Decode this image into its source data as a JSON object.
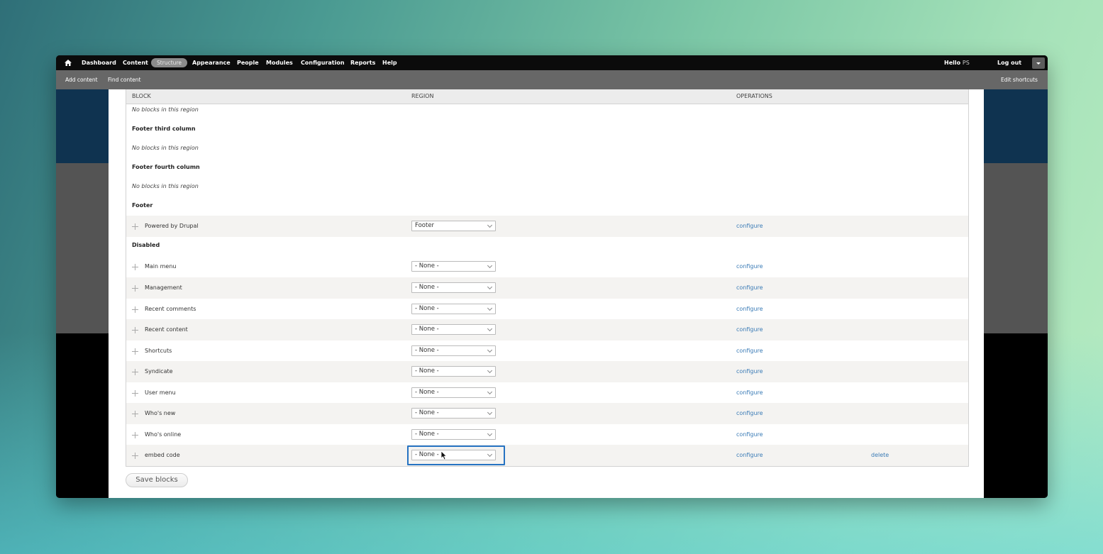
{
  "toolbar": {
    "dashboard": "Dashboard",
    "content": "Content",
    "structure": "Structure",
    "appearance": "Appearance",
    "people": "People",
    "modules": "Modules",
    "configuration": "Configuration",
    "reports": "Reports",
    "help": "Help",
    "hello_label": "Hello",
    "user_name": "PS",
    "logout": "Log out"
  },
  "shortcuts": {
    "add_content": "Add content",
    "find_content": "Find content",
    "edit_shortcuts": "Edit shortcuts"
  },
  "table": {
    "headers": [
      "BLOCK",
      "REGION",
      "OPERATIONS"
    ],
    "empty_text": "No blocks in this region",
    "regions": {
      "footer_third": "Footer third column",
      "footer_fourth": "Footer fourth column",
      "footer": "Footer",
      "disabled": "Disabled"
    },
    "rows": [
      {
        "block": "Powered by Drupal",
        "region": "Footer",
        "configure": "configure"
      },
      {
        "block": "Main menu",
        "region": "- None -",
        "configure": "configure"
      },
      {
        "block": "Management",
        "region": "- None -",
        "configure": "configure"
      },
      {
        "block": "Recent comments",
        "region": "- None -",
        "configure": "configure"
      },
      {
        "block": "Recent content",
        "region": "- None -",
        "configure": "configure"
      },
      {
        "block": "Shortcuts",
        "region": "- None -",
        "configure": "configure"
      },
      {
        "block": "Syndicate",
        "region": "- None -",
        "configure": "configure"
      },
      {
        "block": "User menu",
        "region": "- None -",
        "configure": "configure"
      },
      {
        "block": "Who's new",
        "region": "- None -",
        "configure": "configure"
      },
      {
        "block": "Who's online",
        "region": "- None -",
        "configure": "configure"
      },
      {
        "block": "embed code",
        "region": "- None -",
        "configure": "configure",
        "delete": "delete"
      }
    ]
  },
  "save_button": "Save blocks",
  "icons": {
    "home": "home-icon",
    "drag": "drag-handle-icon",
    "cursor": "mouse-pointer-icon",
    "dropdown": "chevron-down-icon"
  },
  "colors": {
    "link": "#3a7bb6",
    "focus": "#2673c2",
    "toolbar": "#0b0b0b",
    "shortcut_bar": "#676767"
  }
}
